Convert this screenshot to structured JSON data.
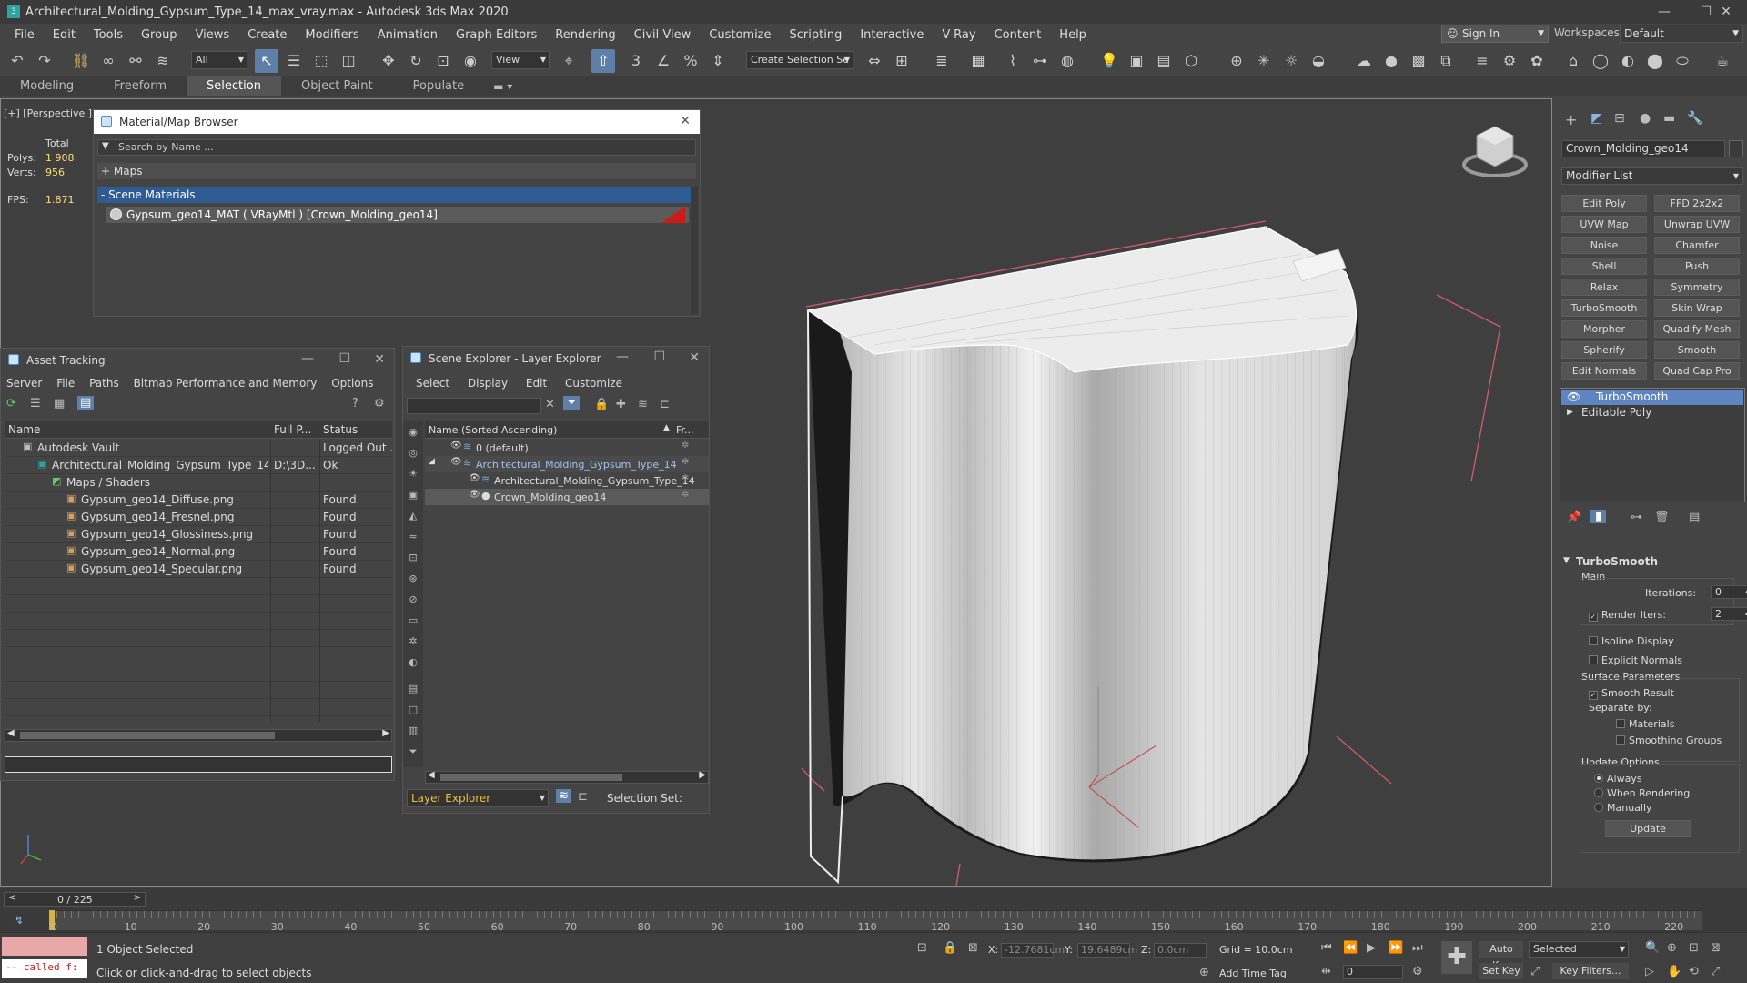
{
  "window": {
    "title": "Architectural_Molding_Gypsum_Type_14_max_vray.max - Autodesk 3ds Max 2020"
  },
  "menu": [
    "File",
    "Edit",
    "Tools",
    "Group",
    "Views",
    "Create",
    "Modifiers",
    "Animation",
    "Graph Editors",
    "Rendering",
    "Civil View",
    "Customize",
    "Scripting",
    "Interactive",
    "V-Ray",
    "Content",
    "Help"
  ],
  "account": {
    "signin": "Sign In",
    "workspaces_label": "Workspaces:",
    "workspace": "Default"
  },
  "toolbar": {
    "filter": "All",
    "refcoord": "View",
    "selection_set": "Create Selection Se"
  },
  "ribbon": {
    "tabs": [
      "Modeling",
      "Freeform",
      "Selection",
      "Object Paint",
      "Populate"
    ],
    "active": "Selection"
  },
  "viewport": {
    "label": "[+] [Perspective ] [",
    "stats": {
      "total": "Total",
      "polys_label": "Polys:",
      "polys": "1 908",
      "verts_label": "Verts:",
      "verts": "956",
      "fps_label": "FPS:",
      "fps": "1.871"
    }
  },
  "material_browser": {
    "title": "Material/Map Browser",
    "search_placeholder": "Search by Name ...",
    "maps": "+ Maps",
    "scene_materials": "- Scene Materials",
    "material": "Gypsum_geo14_MAT ( VRayMtl ) [Crown_Molding_geo14]"
  },
  "asset_tracking": {
    "title": "Asset Tracking",
    "menu": [
      "Server",
      "File",
      "Paths",
      "Bitmap Performance and Memory",
      "Options"
    ],
    "columns": [
      "Name",
      "Full P...",
      "Status"
    ],
    "rows": [
      {
        "name": "Autodesk Vault",
        "path": "",
        "status": "Logged Out ..."
      },
      {
        "name": "Architectural_Molding_Gypsum_Type_14_...",
        "path": "D:\\3D...",
        "status": "Ok"
      },
      {
        "name": "Maps / Shaders",
        "path": "",
        "status": ""
      },
      {
        "name": "Gypsum_geo14_Diffuse.png",
        "path": "",
        "status": "Found"
      },
      {
        "name": "Gypsum_geo14_Fresnel.png",
        "path": "",
        "status": "Found"
      },
      {
        "name": "Gypsum_geo14_Glossiness.png",
        "path": "",
        "status": "Found"
      },
      {
        "name": "Gypsum_geo14_Normal.png",
        "path": "",
        "status": "Found"
      },
      {
        "name": "Gypsum_geo14_Specular.png",
        "path": "",
        "status": "Found"
      }
    ]
  },
  "scene_explorer": {
    "title": "Scene Explorer - Layer Explorer",
    "menu": [
      "Select",
      "Display",
      "Edit",
      "Customize"
    ],
    "col_name": "Name (Sorted Ascending)",
    "col_fr": "Fr...",
    "rows": [
      {
        "name": "0 (default)",
        "indent": 0
      },
      {
        "name": "Architectural_Molding_Gypsum_Type_14",
        "indent": 0
      },
      {
        "name": "Architectural_Molding_Gypsum_Type_14",
        "indent": 1
      },
      {
        "name": "Crown_Molding_geo14",
        "indent": 1
      }
    ],
    "footer_explorer": "Layer Explorer",
    "footer_selset": "Selection Set:"
  },
  "command_panel": {
    "object_name": "Crown_Molding_geo14",
    "modifier_list": "Modifier List",
    "buttons": [
      "Edit Poly",
      "FFD 2x2x2",
      "UVW Map",
      "Unwrap UVW",
      "Noise",
      "Chamfer",
      "Shell",
      "Push",
      "Relax",
      "Symmetry",
      "TurboSmooth",
      "Skin Wrap",
      "Morpher",
      "Quadify Mesh",
      "Spherify",
      "Smooth",
      "Edit Normals",
      "Quad Cap Pro"
    ],
    "stack": [
      "TurboSmooth",
      "Editable Poly"
    ],
    "turbosmooth": {
      "title": "TurboSmooth",
      "main": "Main",
      "iterations_label": "Iterations:",
      "iterations": "0",
      "render_iters_label": "Render Iters:",
      "render_iters": "2",
      "isoline": "Isoline Display",
      "explicit": "Explicit Normals",
      "surface": "Surface Parameters",
      "smooth_result": "Smooth Result",
      "separate": "Separate by:",
      "materials": "Materials",
      "smoothing": "Smoothing Groups",
      "update_options": "Update Options",
      "always": "Always",
      "when_rendering": "When Rendering",
      "manually": "Manually",
      "update": "Update"
    }
  },
  "timeline": {
    "frame": "0 / 225",
    "ticks": [
      "0",
      "10",
      "20",
      "30",
      "40",
      "50",
      "60",
      "70",
      "80",
      "90",
      "100",
      "110",
      "120",
      "130",
      "140",
      "150",
      "160",
      "170",
      "180",
      "190",
      "200",
      "210",
      "220"
    ]
  },
  "status": {
    "script": "-- called f:",
    "selected": "1 Object Selected",
    "hint": "Click or click-and-drag to select objects",
    "x_label": "X:",
    "x": "-12.7681cm",
    "y_label": "Y:",
    "y": "19.6489cm",
    "z_label": "Z:",
    "z": "0.0cm",
    "grid": "Grid = 10.0cm",
    "add_time_tag": "Add Time Tag",
    "auto_key": "Auto Key",
    "selected_mode": "Selected",
    "set_key": "Set Key",
    "key_filters": "Key Filters...",
    "frame_field": "0"
  }
}
